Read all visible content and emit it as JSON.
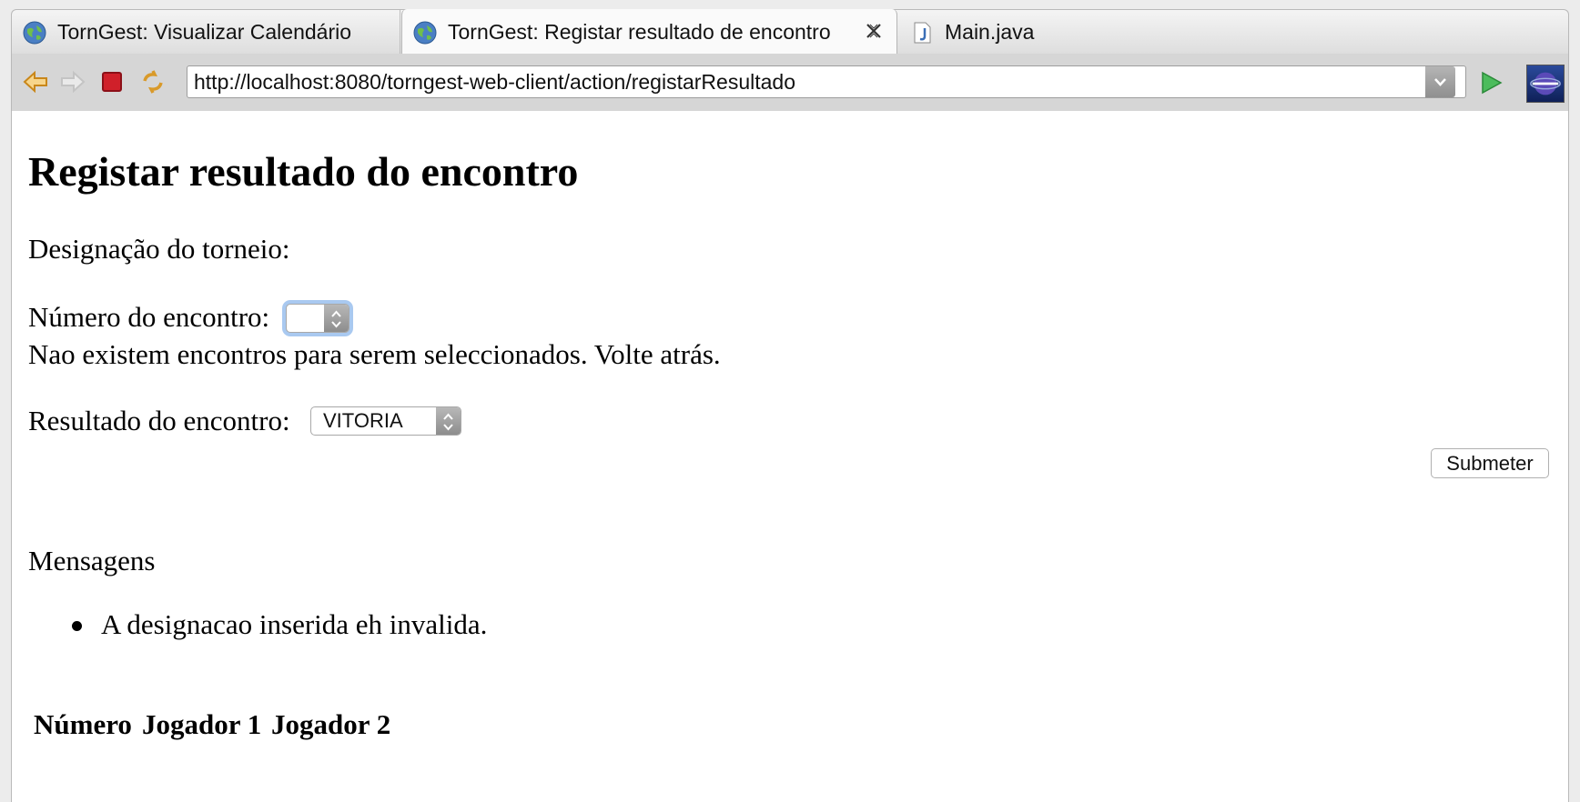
{
  "tabs": [
    {
      "label": "TornGest: Visualizar Calendário",
      "icon": "globe-icon",
      "active": false
    },
    {
      "label": "TornGest: Registar resultado de encontro",
      "icon": "globe-icon",
      "active": true
    },
    {
      "label": "Main.java",
      "icon": "java-file-icon",
      "active": false
    }
  ],
  "toolbar": {
    "url": "http://localhost:8080/torngest-web-client/action/registarResultado"
  },
  "page": {
    "title": "Registar resultado do encontro",
    "designacao_label": "Designação do torneio:",
    "numero_label": "Número do encontro:",
    "numero_value": "",
    "no_encounters_msg": "Nao existem encontros para serem seleccionados. Volte atrás.",
    "resultado_label": "Resultado do encontro:",
    "resultado_value": "VITORIA",
    "submit_label": "Submeter",
    "messages_heading": "Mensagens",
    "messages": [
      "A designacao inserida eh invalida."
    ],
    "table_headers": [
      "Número",
      "Jogador 1",
      "Jogador 2"
    ]
  },
  "colors": {
    "focus_ring": "#a9c9f0",
    "go_arrow": "#3aa14a",
    "stop": "#d0202a",
    "nav_arrow": "#e6a92c"
  }
}
